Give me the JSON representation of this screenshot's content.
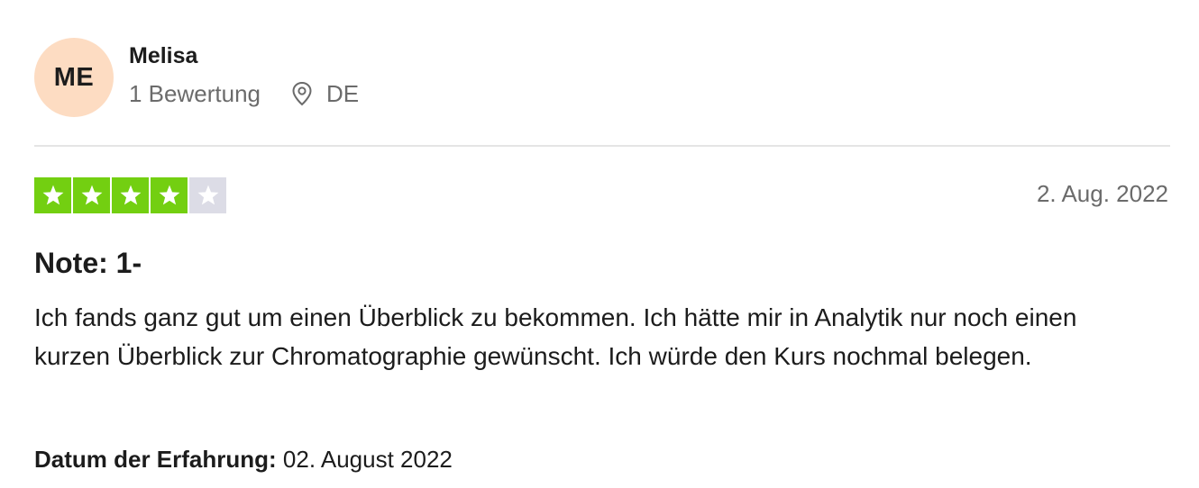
{
  "consumer": {
    "initials": "ME",
    "name": "Melisa",
    "review_count": "1 Bewertung",
    "country": "DE"
  },
  "review": {
    "rating": 4,
    "max_rating": 5,
    "date": "2. Aug. 2022",
    "title": "Note: 1-",
    "text": "Ich fands ganz gut um einen Überblick zu bekommen. Ich hätte mir in Analytik nur noch einen kurzen Überblick zur Chromatographie gewünscht. Ich würde den Kurs nochmal belegen.",
    "experience_label": "Datum der Erfahrung:",
    "experience_date": "02. August 2022"
  },
  "icons": {
    "location": "location-pin-icon",
    "star": "star-icon"
  },
  "colors": {
    "star_filled": "#73cf11",
    "star_empty": "#dcdce6",
    "avatar_bg": "#fddcc2",
    "muted_text": "#6b6b6b"
  }
}
